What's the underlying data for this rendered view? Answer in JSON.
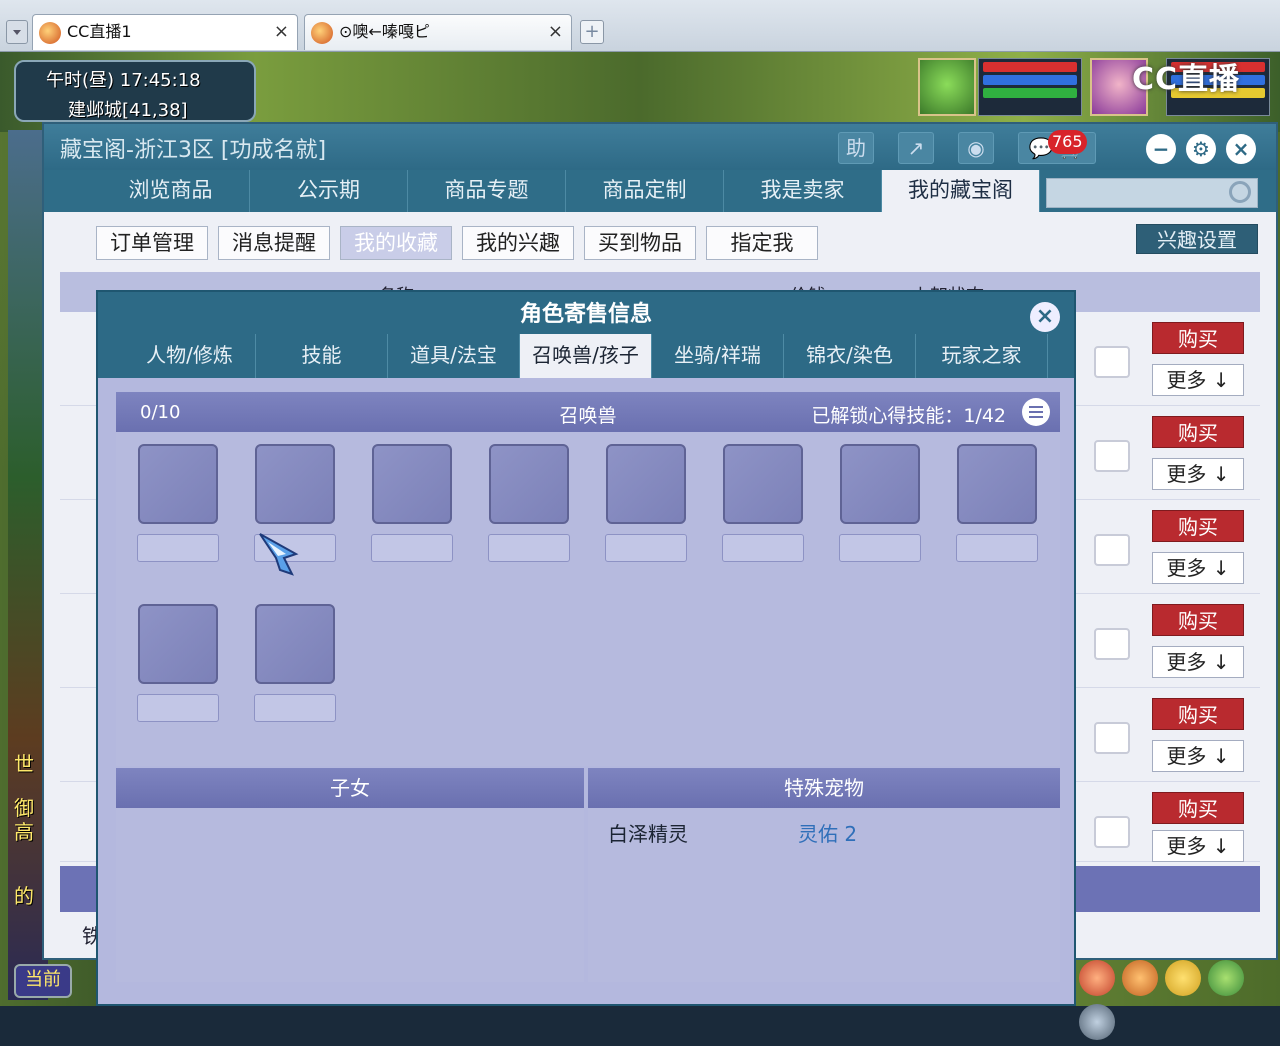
{
  "browser": {
    "tabs": [
      {
        "label": "CC直播1",
        "close": "×"
      },
      {
        "label": "⊙噢←嗪嘎ピ",
        "close": "×"
      }
    ],
    "new_tab": "+"
  },
  "game_hud": {
    "time": "午时(昼)  17:45:18",
    "location": "建邺城[41,38]",
    "watermark": "CC直播",
    "left_labels": [
      "世",
      "御",
      "高",
      "的",
      "铁"
    ],
    "current_btn": "当前"
  },
  "window": {
    "title": "藏宝阁-浙江3区 [功成名就]",
    "help_btn": "助",
    "badge_count": "765",
    "nav_tabs": [
      "浏览商品",
      "公示期",
      "商品专题",
      "商品定制",
      "我是卖家",
      "我的藏宝阁"
    ],
    "active_nav": 5,
    "sub_tabs": [
      "订单管理",
      "消息提醒",
      "我的收藏",
      "我的兴趣",
      "买到物品",
      "指定我"
    ],
    "active_sub": 2,
    "interest_settings": "兴趣设置",
    "list_columns": [
      "名称",
      "",
      "价钱",
      "上架状态"
    ],
    "rows": [
      {
        "buy": "购买",
        "more": "更多"
      },
      {
        "buy": "购买",
        "more": "更多"
      },
      {
        "buy": "购买",
        "more": "更多"
      },
      {
        "buy": "购买",
        "more": "更多"
      },
      {
        "buy": "购买",
        "more": "更多"
      },
      {
        "buy": "购买",
        "more": "更多"
      }
    ],
    "footer_text": "铁"
  },
  "popup": {
    "title": "角色寄售信息",
    "tabs": [
      "人物/修炼",
      "技能",
      "道具/法宝",
      "召唤兽/孩子",
      "坐骑/祥瑞",
      "锦衣/染色",
      "玩家之家"
    ],
    "active_tab": 3,
    "summon": {
      "count": "0/10",
      "heading": "召唤兽",
      "unlocked": "已解锁心得技能：1/42"
    },
    "children_heading": "子女",
    "special_heading": "特殊宠物",
    "special_pet": {
      "name": "白泽精灵",
      "value": "灵佑 2"
    }
  },
  "colors": {
    "title_blue": "#2e6a86",
    "buy_red": "#b92a2f",
    "panel_purple": "#b4b8de"
  }
}
